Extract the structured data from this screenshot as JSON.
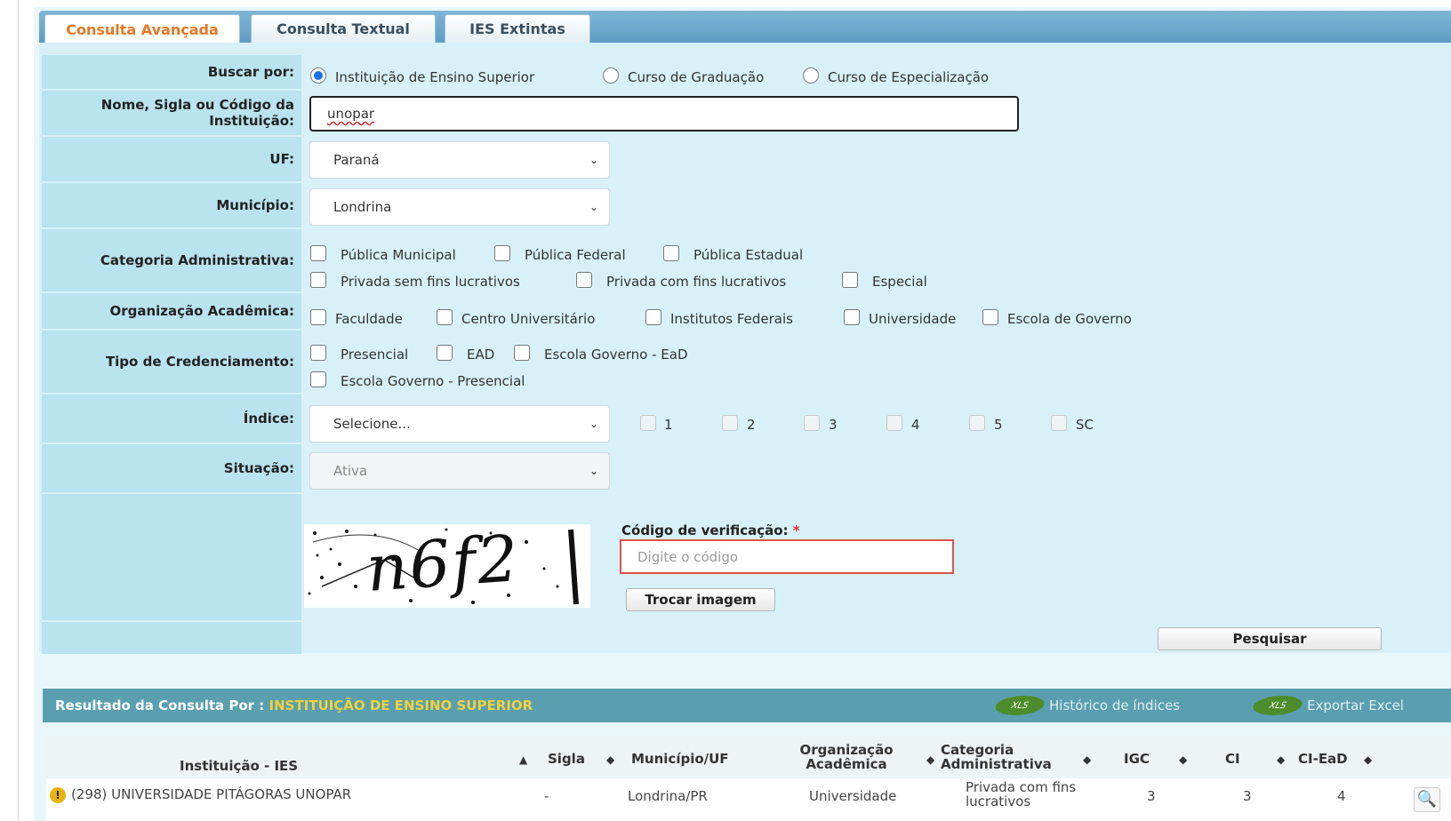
{
  "tabs": [
    "Consulta Avançada",
    "Consulta Textual",
    "IES Extintas"
  ],
  "form": {
    "buscar_por_label": "Buscar por:",
    "buscar_options": [
      "Instituição de Ensino Superior",
      "Curso de Graduação",
      "Curso de Especialização"
    ],
    "buscar_selected": "Instituição de Ensino Superior",
    "nome_label": "Nome, Sigla ou Código da Instituição:",
    "nome_value": "unopar",
    "uf_label": "UF:",
    "uf_value": "Paraná",
    "municipio_label": "Município:",
    "municipio_value": "Londrina",
    "categoria_label": "Categoria Administrativa:",
    "categoria_options": [
      "Pública Municipal",
      "Pública Federal",
      "Pública Estadual",
      "Privada sem fins lucrativos",
      "Privada com fins lucrativos",
      "Especial"
    ],
    "organizacao_label": "Organização Acadêmica:",
    "organizacao_options": [
      "Faculdade",
      "Centro Universitário",
      "Institutos Federais",
      "Universidade",
      "Escola de Governo"
    ],
    "credenciamento_label": "Tipo de Credenciamento:",
    "credenciamento_options": [
      "Presencial",
      "EAD",
      "Escola Governo - EaD",
      "Escola Governo - Presencial"
    ],
    "indice_label": "Índice:",
    "indice_value": "Selecione...",
    "indice_options": [
      "1",
      "2",
      "3",
      "4",
      "5",
      "SC"
    ],
    "situacao_label": "Situação:",
    "situacao_value": "Ativa",
    "captcha_text": "n6f2",
    "codigo_label": "Código de verificação:",
    "codigo_required": "*",
    "codigo_placeholder": "Digite o código",
    "trocar_label": "Trocar imagem",
    "pesquisar_label": "Pesquisar"
  },
  "results": {
    "title_prefix": "Resultado da Consulta Por :",
    "title_value": "INSTITUIÇÃO DE ENSINO SUPERIOR",
    "historico_label": "Histórico de índices",
    "exportar_label": "Exportar Excel",
    "columns": {
      "instituicao": "Instituição - IES",
      "sigla": "Sigla",
      "municipio": "Município/UF",
      "organizacao": "Organização Acadêmica",
      "categoria": "Categoria Administrativa",
      "igc": "IGC",
      "ci": "CI",
      "ci_ead": "CI-EaD"
    },
    "rows": [
      {
        "warning": "!",
        "instituicao": "(298) UNIVERSIDADE PITÁGORAS UNOPAR",
        "sigla": "-",
        "municipio": "Londrina/PR",
        "organizacao": "Universidade",
        "categoria": "Privada com fins lucrativos",
        "igc": "3",
        "ci": "3",
        "ci_ead": "4"
      }
    ]
  },
  "icons": {
    "sort_asc": "▲",
    "sort_both": "◆",
    "chevron": "⌄",
    "magnifier": "🔍"
  }
}
